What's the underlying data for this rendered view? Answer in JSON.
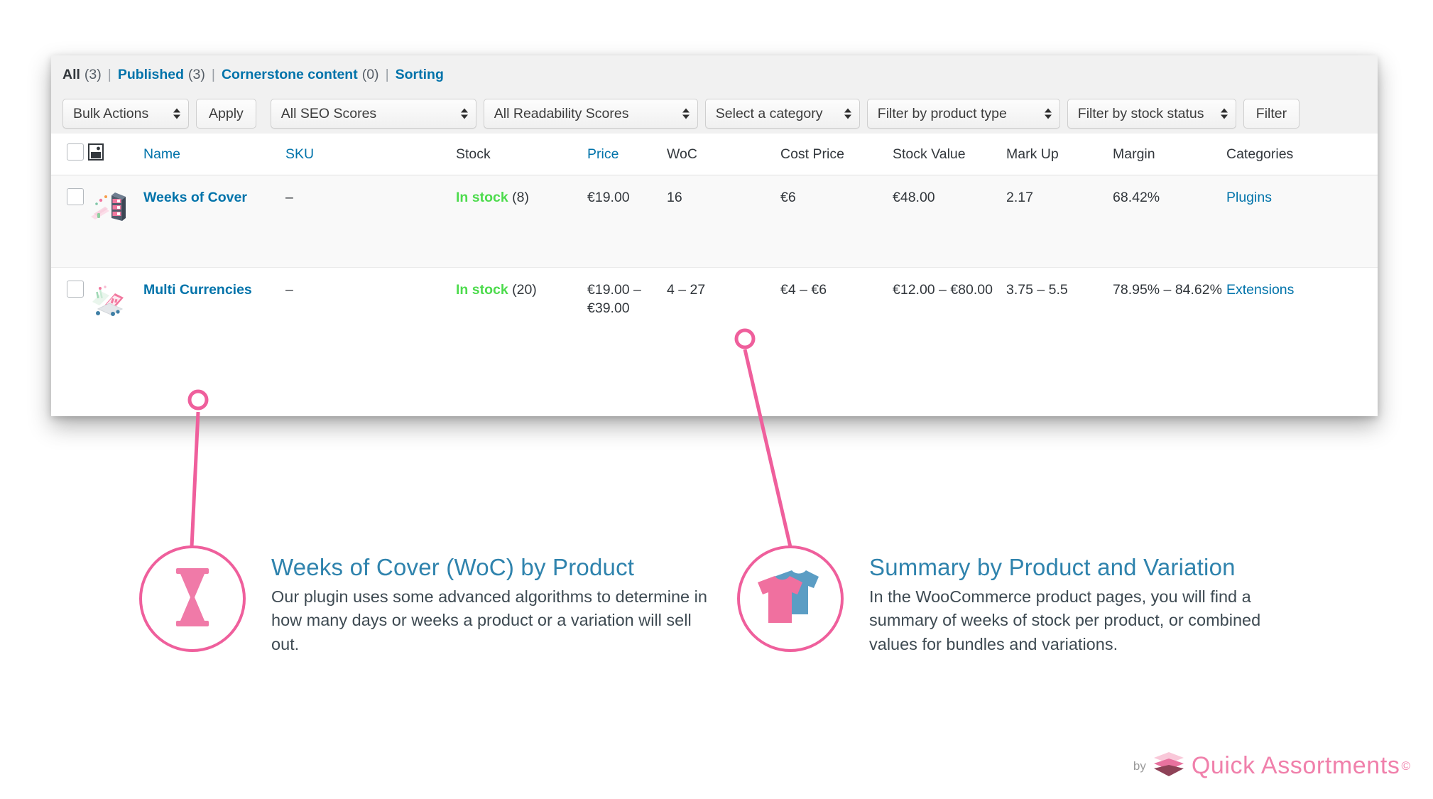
{
  "colors": {
    "accent_pink": "#ef5f9c",
    "link_blue": "#0073aa",
    "title_blue": "#2f83ad",
    "in_stock_green": "#4ddb4d",
    "brand_pink": "#f080ab"
  },
  "list_table": {
    "views": {
      "items": [
        {
          "label": "All",
          "count": "(3)",
          "current": true
        },
        {
          "label": "Published",
          "count": "(3)",
          "current": false
        },
        {
          "label": "Cornerstone content",
          "count": "(0)",
          "current": false
        },
        {
          "label": "Sorting",
          "count": "",
          "current": false
        }
      ],
      "separator": "|"
    },
    "tablenav": {
      "bulk_actions": "Bulk Actions",
      "apply_label": "Apply",
      "seo_scores": "All SEO Scores",
      "readability_scores": "All Readability Scores",
      "category": "Select a category",
      "product_type": "Filter by product type",
      "stock_status": "Filter by stock status",
      "filter_label": "Filter"
    },
    "columns": [
      {
        "key": "cb",
        "label": "",
        "link": false
      },
      {
        "key": "thumb",
        "label": "",
        "link": false
      },
      {
        "key": "name",
        "label": "Name",
        "link": true
      },
      {
        "key": "sku",
        "label": "SKU",
        "link": true
      },
      {
        "key": "stock",
        "label": "Stock",
        "link": false
      },
      {
        "key": "price",
        "label": "Price",
        "link": true
      },
      {
        "key": "woc",
        "label": "WoC",
        "link": false
      },
      {
        "key": "cost",
        "label": "Cost Price",
        "link": false
      },
      {
        "key": "sval",
        "label": "Stock Value",
        "link": false
      },
      {
        "key": "mark",
        "label": "Mark Up",
        "link": false
      },
      {
        "key": "marg",
        "label": "Margin",
        "link": false
      },
      {
        "key": "cat",
        "label": "Categories",
        "link": false
      }
    ],
    "rows": [
      {
        "name": "Weeks of Cover",
        "sku": "–",
        "stock_label": "In stock",
        "stock_qty": "(8)",
        "price": "€19.00",
        "woc": "16",
        "cost_price": "€6",
        "stock_value": "€48.00",
        "mark_up": "2.17",
        "margin": "68.42%",
        "categories": "Plugins",
        "thumbnail": "shelf-illustration"
      },
      {
        "name": "Multi Currencies",
        "sku": "–",
        "stock_label": "In stock",
        "stock_qty": "(20)",
        "price": "€19.00 – €39.00",
        "woc": "4 – 27",
        "cost_price": "€4 – €6",
        "stock_value": "€12.00 – €80.00",
        "mark_up": "3.75 – 5.5",
        "margin": "78.95% – 84.62%",
        "categories": "Extensions",
        "thumbnail": "laptop-illustration"
      }
    ]
  },
  "callouts": [
    {
      "icon": "hourglass-icon",
      "title": "Weeks of Cover (WoC) by Product",
      "body": "Our plugin uses some advanced algorithms to determine in how many days or weeks a product or a variation will sell out."
    },
    {
      "icon": "tshirts-icon",
      "title": "Summary by Product and Variation",
      "body": "In the WooCommerce product pages, you will find a summary of weeks of stock per product, or combined values for bundles and variations."
    }
  ],
  "footer": {
    "by": "by",
    "brand": "Quick Assortments",
    "copyright_mark": "©"
  }
}
